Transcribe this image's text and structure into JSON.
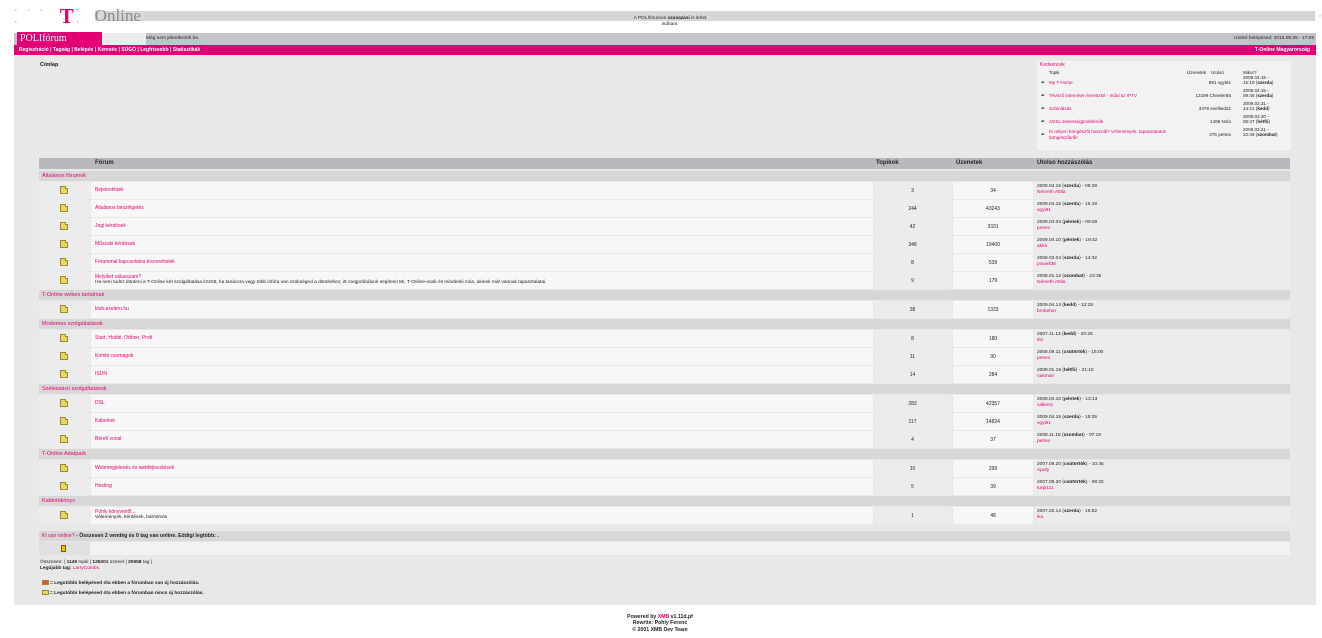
{
  "header": {
    "logo_dots_left": "· · · ·",
    "logo_t": "T",
    "logo_dots_mid": "· ·",
    "logo_text": "Online",
    "logo_dot_right": "·",
    "top_note_line1_pre": "A POLIfórumon ",
    "top_note_bold": "szavazási",
    "top_note_line1_post": " is lehet",
    "top_note_line2": "indítani.",
    "site_name": "POLIfórum",
    "not_logged": "Még nem jelentkeztél be.",
    "last_login": "Utolsó belépésed: 2015.09.29 - 17:09"
  },
  "nav": {
    "items": [
      "Regisztráció",
      "Tagság",
      "Belépés",
      "Keresés",
      "SÚGÓ",
      "Legfrissebb",
      "Statisztikák"
    ],
    "separator": "|",
    "right_link": "T-Online Magyarország"
  },
  "breadcrumb": "Címlap",
  "favourites": {
    "title": "Kedvencek",
    "headers": [
      "Topik",
      "Üzenetek",
      "Utolsó",
      "Mikor?"
    ],
    "rows": [
      {
        "topic": "My T-Home",
        "messages": "981",
        "last_user": "vgyi91",
        "date": "2009.04.15 -",
        "time": "15:19",
        "day": "szerda"
      },
      {
        "topic": "Tévéző interneten keresztül - Indul az IPTV",
        "messages": "13199",
        "last_user": "Cheeter85",
        "date": "2009.04.15 -",
        "time": "09:45",
        "day": "szerda"
      },
      {
        "topic": "Számlázás",
        "messages": "3476",
        "last_user": "evellied22",
        "date": "2009.03.31 -",
        "time": "14:21",
        "day": "kedd"
      },
      {
        "topic": "ADSL sebességproblémák",
        "messages": "1498",
        "last_user": "Nolo",
        "date": "2009.03.30 -",
        "time": "05:47",
        "day": "hétfő"
      },
      {
        "topic": "Ki milyen böngészőt használ? Vélemények, tapasztalatok böngészőkről!",
        "messages": "375",
        "last_user": "petrex",
        "date": "2009.03.21 -",
        "time": "22:49",
        "day": "szombat"
      }
    ]
  },
  "table": {
    "headers": [
      "Fórum",
      "Topikok",
      "Üzenetek",
      "Utolsó hozzászólás"
    ],
    "categories": [
      {
        "name": "Általános fórumok",
        "forums": [
          {
            "name": "Bejelentések",
            "desc": "",
            "topics": "3",
            "posts": "34",
            "last_date": "2009.04.15",
            "last_day": "szerda",
            "last_time": "09:38",
            "last_user": "Németh Attila"
          },
          {
            "name": "Általános beszélgetés",
            "desc": "",
            "topics": "244",
            "posts": "43243",
            "last_date": "2009.04.15",
            "last_day": "szerda",
            "last_time": "15:19",
            "last_user": "vgyi91"
          },
          {
            "name": "Jogi kérdések",
            "desc": "",
            "topics": "42",
            "posts": "3331",
            "last_date": "2009.04.03",
            "last_day": "péntek",
            "last_time": "09:59",
            "last_user": "petrex"
          },
          {
            "name": "Műszaki kérdések",
            "desc": "",
            "topics": "348",
            "posts": "19400",
            "last_date": "2009.04.10",
            "last_day": "péntek",
            "last_time": "19:42",
            "last_user": "akka"
          },
          {
            "name": "Fórummal kapcsolatos észrevételek",
            "desc": "",
            "topics": "8",
            "posts": "539",
            "last_date": "2009.03.04",
            "last_day": "szerda",
            "last_time": "14:32",
            "last_user": "powell35"
          },
          {
            "name": "Melyiket válasszam?",
            "desc": "Ha nem tudsz dönteni a T-Online két szolgáltatása között, ha tanácsra vagy több infóra van szükséged a döntéshez, itt megpróbálunk segíteni! Mi, T-Online-osok és mindenki más, akinek már vannak tapasztalatai.",
            "topics": "9",
            "posts": "179",
            "last_date": "2008.01.12",
            "last_day": "szombat",
            "last_time": "23:35",
            "last_user": "Németh Attila"
          }
        ]
      },
      {
        "name": "T-Online webes tartalmak",
        "forums": [
          {
            "name": "klub.axelero.hu",
            "desc": "",
            "topics": "38",
            "posts": "1333",
            "last_date": "2009.04.14",
            "last_day": "kedd",
            "last_time": "12:25",
            "last_user": "brobeher"
          }
        ]
      },
      {
        "name": "Modemes szolgáltatások",
        "forums": [
          {
            "name": "Start, Hobbi, Otthon, Profi",
            "desc": "",
            "topics": "8",
            "posts": "180",
            "last_date": "2007.11.13",
            "last_day": "kedd",
            "last_time": "20:26",
            "last_user": "tbz"
          },
          {
            "name": "Kombi csomagok",
            "desc": "",
            "topics": "11",
            "posts": "90",
            "last_date": "2008.09.11",
            "last_day": "csütörtök",
            "last_time": "15:00",
            "last_user": "petrex"
          },
          {
            "name": "ISDN",
            "desc": "",
            "topics": "14",
            "posts": "284",
            "last_date": "2009.01.19",
            "last_day": "hétfő",
            "last_time": "21:10",
            "last_user": "nakmari"
          }
        ]
      },
      {
        "name": "Szélessávú szolgáltatások",
        "forums": [
          {
            "name": "DSL",
            "desc": "",
            "topics": "283",
            "posts": "42357",
            "last_date": "2009.04.10",
            "last_day": "péntek",
            "last_time": "13:13",
            "last_user": "valkesz"
          },
          {
            "name": "Kábelnet",
            "desc": "",
            "topics": "117",
            "posts": "14824",
            "last_date": "2009.04.15",
            "last_day": "szerda",
            "last_time": "15:05",
            "last_user": "vgyi91"
          },
          {
            "name": "Bérelt vonal",
            "desc": "",
            "topics": "4",
            "posts": "37",
            "last_date": "2008.11.15",
            "last_day": "szombat",
            "last_time": "07:19",
            "last_user": "petrex"
          }
        ]
      },
      {
        "name": "T-Online Adatpark",
        "forums": [
          {
            "name": "Webmegjelenés és webfejlesztések",
            "desc": "",
            "topics": "10",
            "posts": "299",
            "last_date": "2007.09.20",
            "last_day": "csütörtök",
            "last_time": "10:46",
            "last_user": "Apafy"
          },
          {
            "name": "Hosting",
            "desc": "",
            "topics": "5",
            "posts": "39",
            "last_date": "2007.09.20",
            "last_day": "csütörtök",
            "last_time": "08:32",
            "last_user": "turpi111"
          }
        ]
      },
      {
        "name": "Kattintókönyv",
        "forums": [
          {
            "name": "Pohly könyveiről...",
            "desc": "Vélemények, kérdések, bármimás",
            "topics": "1",
            "posts": "48",
            "last_date": "2007.02.14",
            "last_day": "szerda",
            "last_time": "16:52",
            "last_user": "ika"
          }
        ]
      }
    ]
  },
  "online": {
    "label": "Ki van online?",
    "text": " - Összesen 2 vendég és 0 tag van online. Eddigi legtöbb: ."
  },
  "stats": {
    "pre": "Összesen: |",
    "topics": "1149",
    "topics_label": "topik |",
    "posts": "126301",
    "posts_label": "üzenet |",
    "members": "20558",
    "members_label": "tag |",
    "newest_label": "Legújabb tag:",
    "newest_member": "LarryCombs."
  },
  "legend": {
    "new_posts": "= Legutóbbi belépésed óta ebben a fórumban van új hozzászólás.",
    "no_new_posts": "= Legutóbbi belépésed óta ebben a fórumban nincs új hozzászólás."
  },
  "footer": {
    "powered_pre": "Powered by ",
    "powered_brand": "XMB",
    "powered_version": " v1.11d.pf",
    "rewrite": "Rewrite: Pohly Ferenc",
    "copyright": "© 2001 XMB Dev Team"
  },
  "colors": {
    "accent": "#e20074",
    "header_gray": "#c4c4c8",
    "body_gray": "#e8e8e8"
  }
}
